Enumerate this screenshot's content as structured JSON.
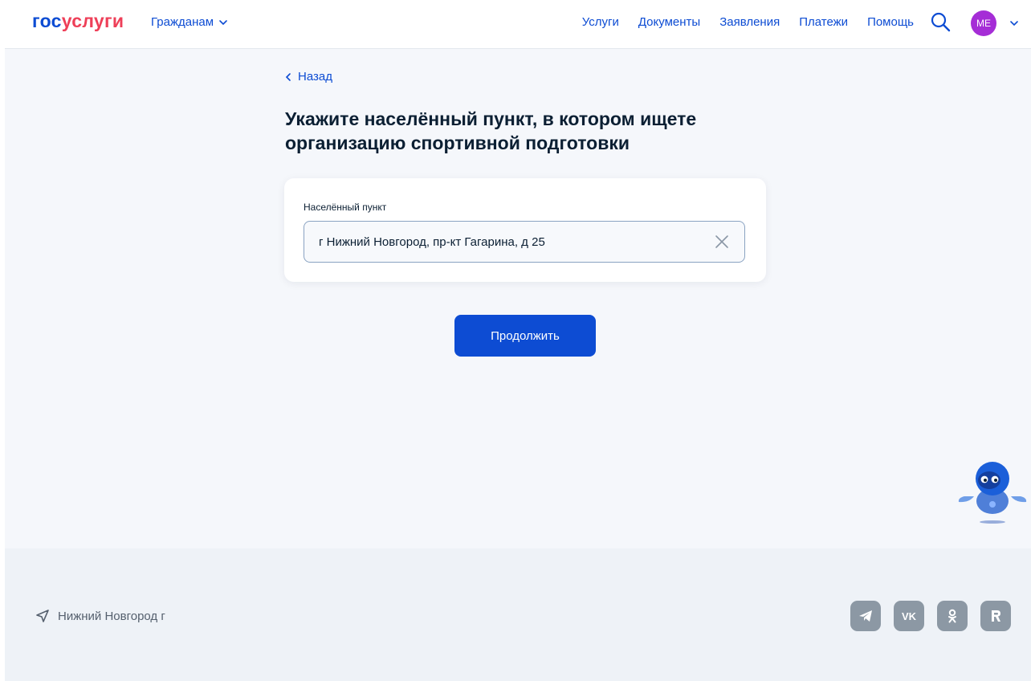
{
  "header": {
    "logo_part1": "гос",
    "logo_part2": "услуги",
    "role_menu": "Гражданам",
    "nav": [
      "Услуги",
      "Документы",
      "Заявления",
      "Платежи",
      "Помощь"
    ],
    "avatar_initials": "ME"
  },
  "main": {
    "back_label": "Назад",
    "title": "Укажите населённый пункт, в котором ищете организацию спортивной подготовки",
    "field_label": "Населённый пункт",
    "field_value": "г Нижний Новгород, пр-кт Гагарина, д 25",
    "continue_label": "Продолжить"
  },
  "footer": {
    "location": "Нижний Новгород г",
    "socials": [
      "telegram-icon",
      "vk-icon",
      "odnoklassniki-icon",
      "rutube-icon"
    ]
  },
  "colors": {
    "brand_blue": "#0d4cd3",
    "brand_red": "#ee3f58",
    "avatar_bg": "#a52dd6",
    "social_bg": "#8c98a4"
  }
}
